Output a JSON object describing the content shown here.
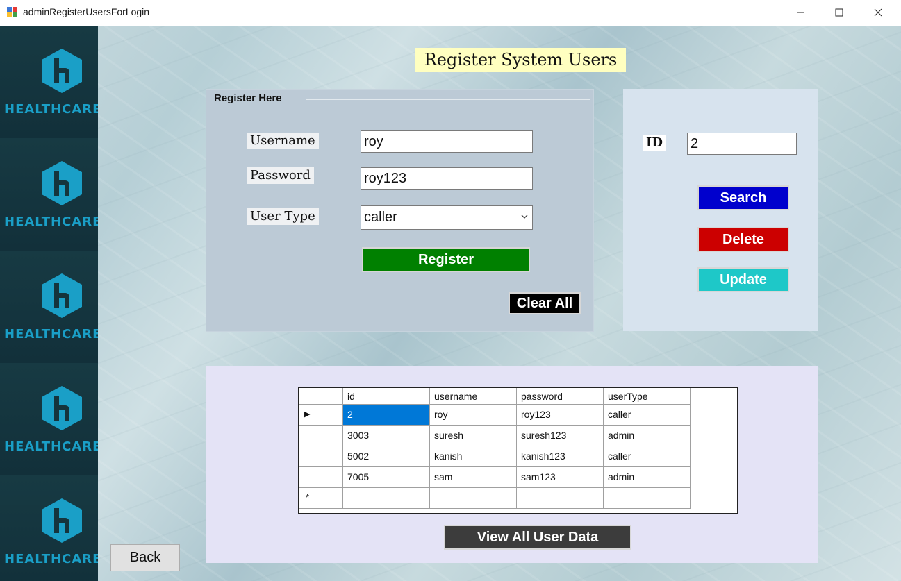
{
  "window": {
    "title": "adminRegisterUsersForLogin",
    "controls": {
      "minimize": "—",
      "maximize": "☐",
      "close": "✕"
    }
  },
  "sidebar": {
    "tiles": [
      {
        "brand": "HEALTHCARE"
      },
      {
        "brand": "HEALTHCARE"
      },
      {
        "brand": "HEALTHCARE"
      },
      {
        "brand": "HEALTHCARE"
      },
      {
        "brand": "HEALTHCARE"
      }
    ],
    "logo_color": "#1a9fc7"
  },
  "page_title": "Register System Users",
  "register": {
    "legend": "Register Here",
    "username_label": "Username",
    "username_value": "roy",
    "password_label": "Password",
    "password_value": "roy123",
    "usertype_label": "User Type",
    "usertype_value": "caller",
    "register_button": "Register",
    "clear_button": "Clear All"
  },
  "id_panel": {
    "id_label": "ID",
    "id_value": "2",
    "search_button": "Search",
    "delete_button": "Delete",
    "update_button": "Update"
  },
  "grid": {
    "columns": [
      "id",
      "username",
      "password",
      "userType"
    ],
    "rows": [
      [
        "2",
        "roy",
        "roy123",
        "caller"
      ],
      [
        "3003",
        "suresh",
        "suresh123",
        "admin"
      ],
      [
        "5002",
        "kanish",
        "kanish123",
        "caller"
      ],
      [
        "7005",
        "sam",
        "sam123",
        "admin"
      ]
    ],
    "current_row_marker": "▶",
    "new_row_marker": "*",
    "view_all_button": "View All User Data"
  },
  "back_button": "Back",
  "colors": {
    "register_btn": "#008000",
    "search_btn": "#0000cd",
    "delete_btn": "#cc0000",
    "update_btn": "#1ec8c8",
    "clear_btn": "#000000",
    "view_btn": "#3c3c3c",
    "title_bg": "#ffffc0"
  }
}
